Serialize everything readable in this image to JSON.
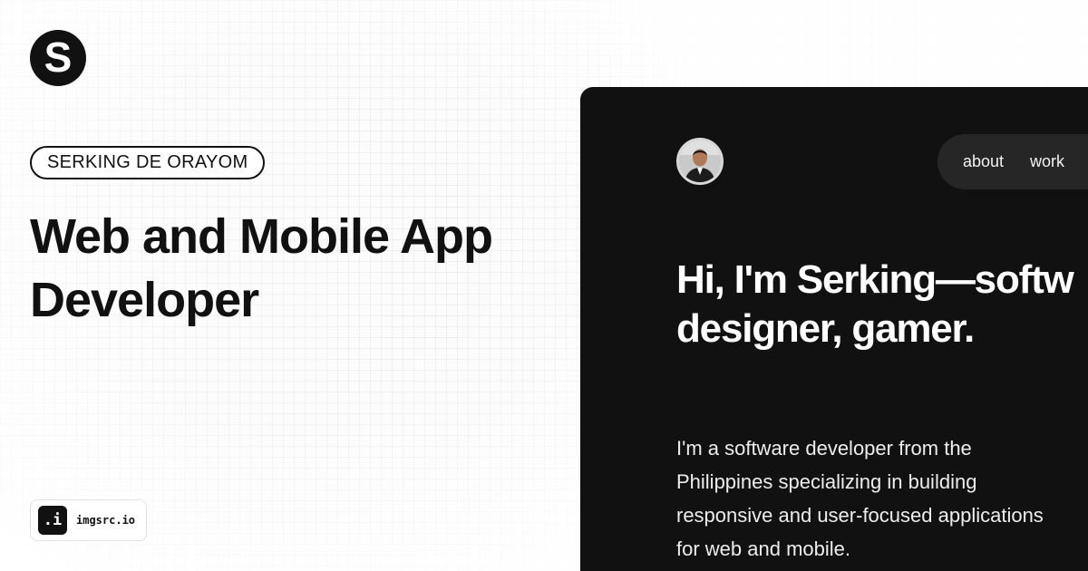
{
  "logo": {
    "letter": "S"
  },
  "name_pill": "SERKING DE ORAYOM",
  "headline": [
    "Web and Mobile App",
    "Developer"
  ],
  "badge": {
    "icon_text": ".i",
    "label": "imgsrc.io"
  },
  "preview": {
    "nav": [
      {
        "label": "about"
      },
      {
        "label": "work"
      }
    ],
    "hero": [
      "Hi, I'm Serking—softw",
      "designer, gamer."
    ],
    "intro": [
      "I'm a software developer from the",
      "Philippines specializing in building",
      "responsive and user-focused applications",
      "for web and mobile."
    ]
  },
  "colors": {
    "background": "#fbfbfb",
    "ink": "#111111",
    "panel": "#111111",
    "nav_pill": "#262626"
  }
}
